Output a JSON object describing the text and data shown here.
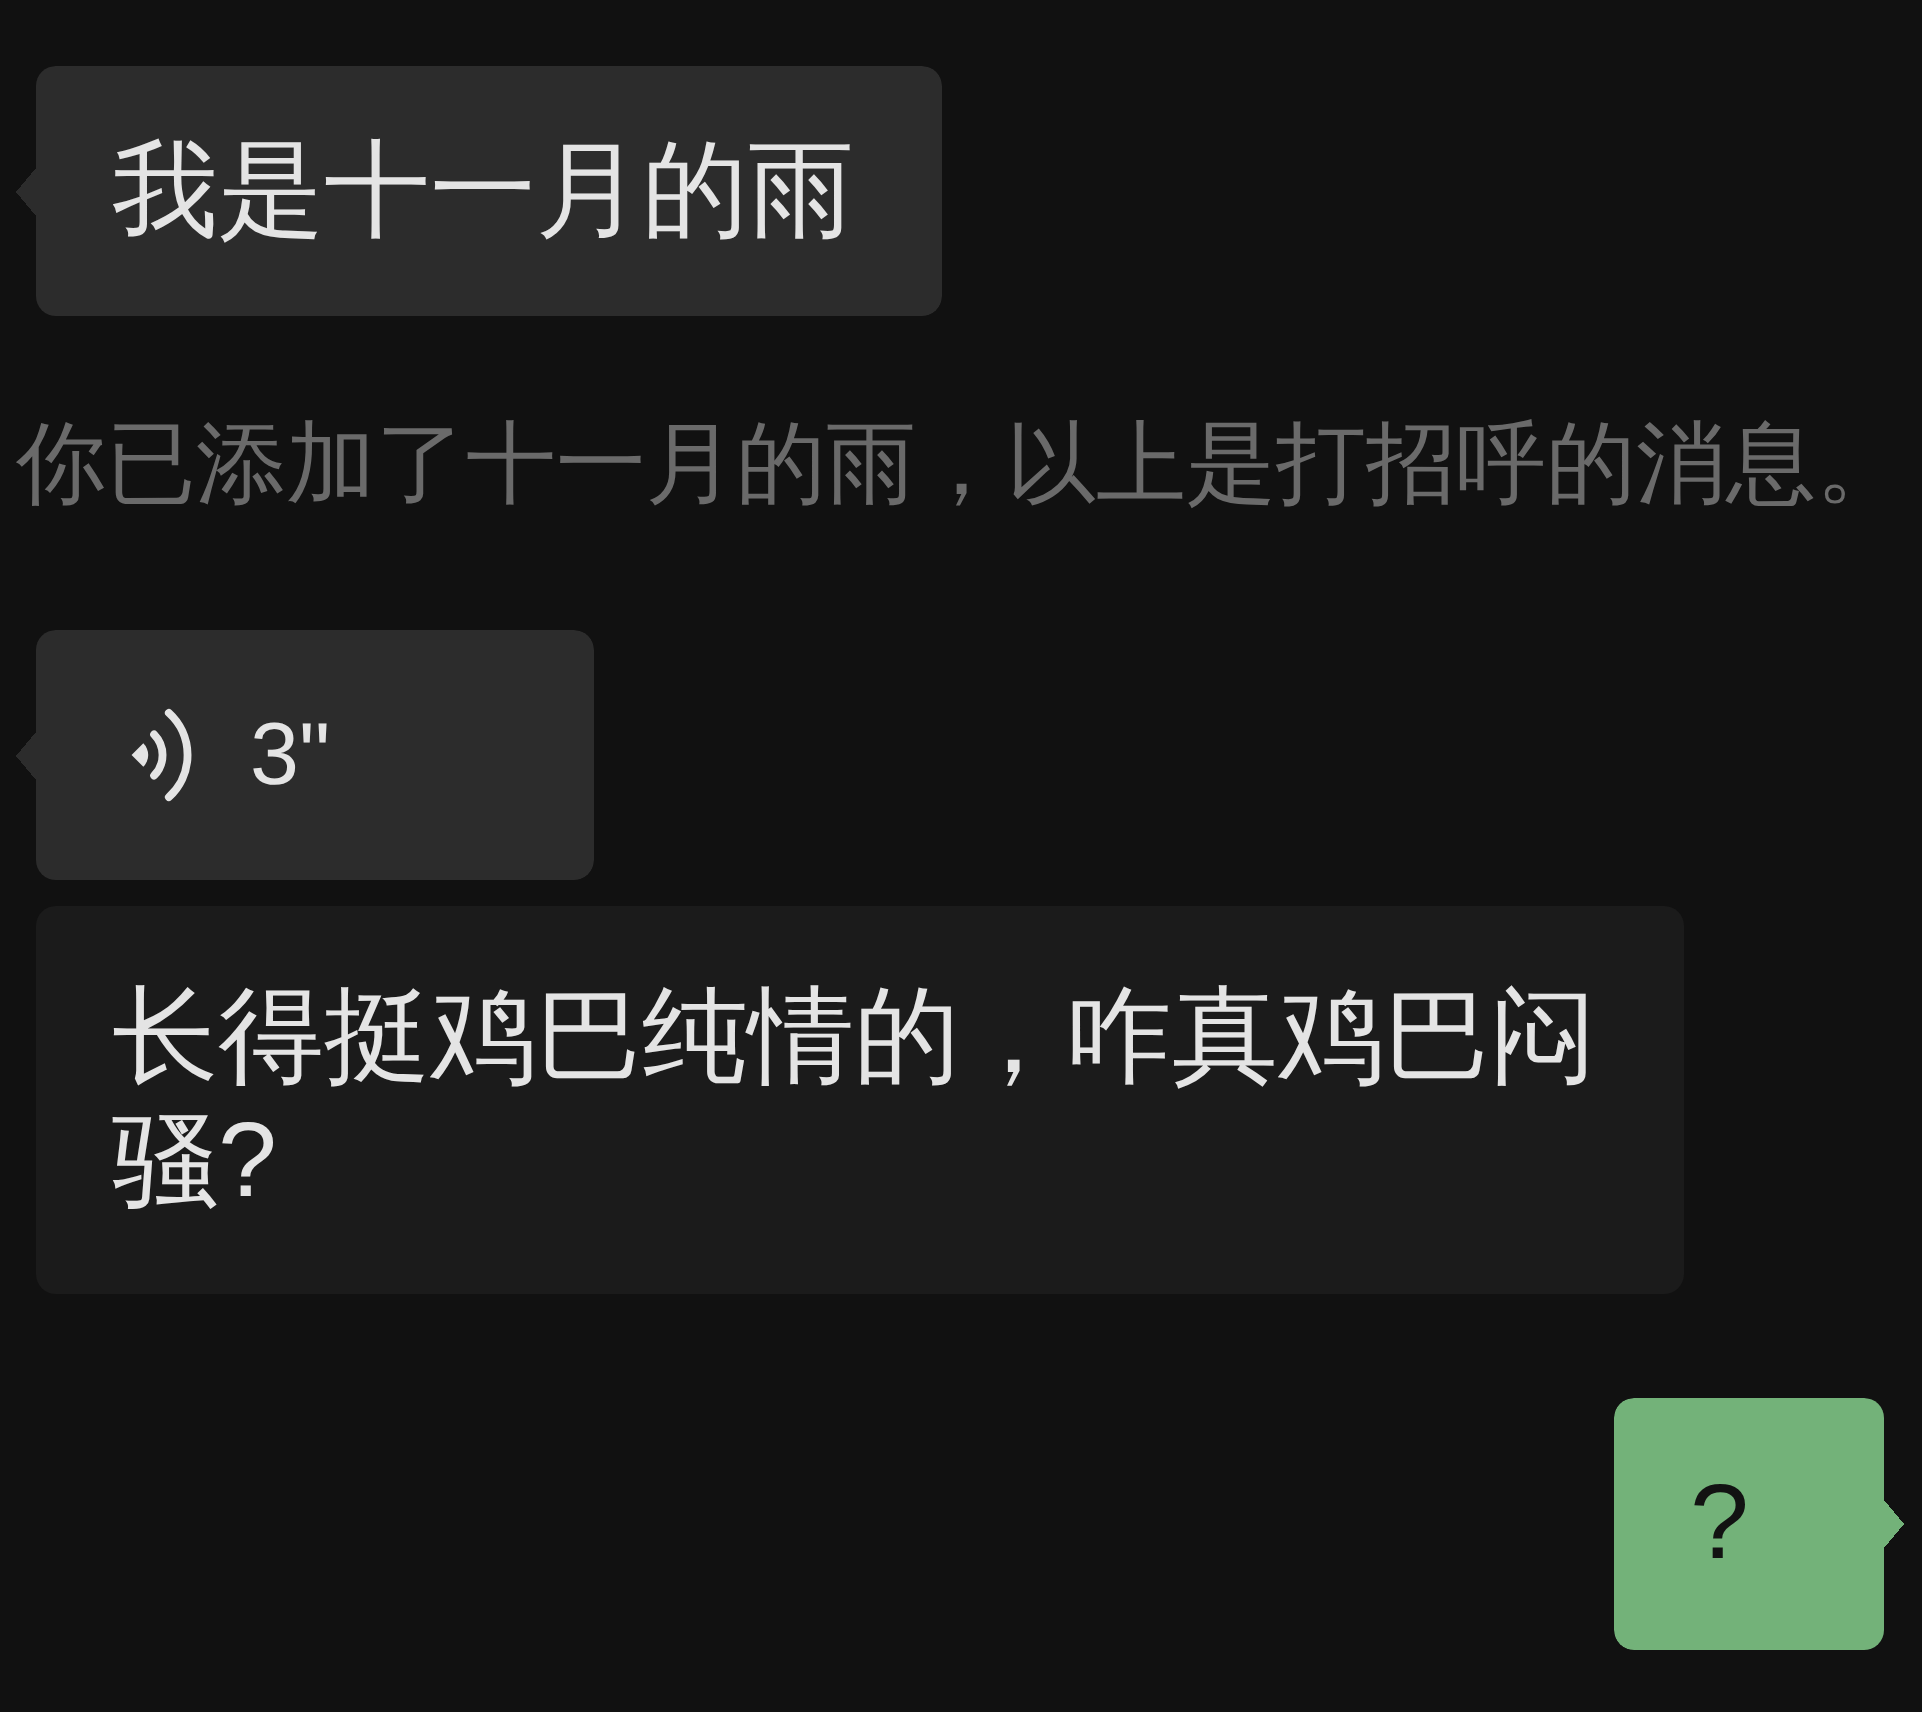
{
  "messages": [
    {
      "kind": "text",
      "outgoing": false,
      "text": "我是十一月的雨"
    },
    {
      "kind": "system",
      "text": "你已添加了十一月的雨，以上是打招呼的消息。"
    },
    {
      "kind": "voice",
      "outgoing": false,
      "duration": "3\""
    },
    {
      "kind": "transcript",
      "text": "长得挺鸡巴纯情的，咋真鸡巴闷骚?"
    },
    {
      "kind": "text",
      "outgoing": true,
      "text": "?"
    }
  ]
}
